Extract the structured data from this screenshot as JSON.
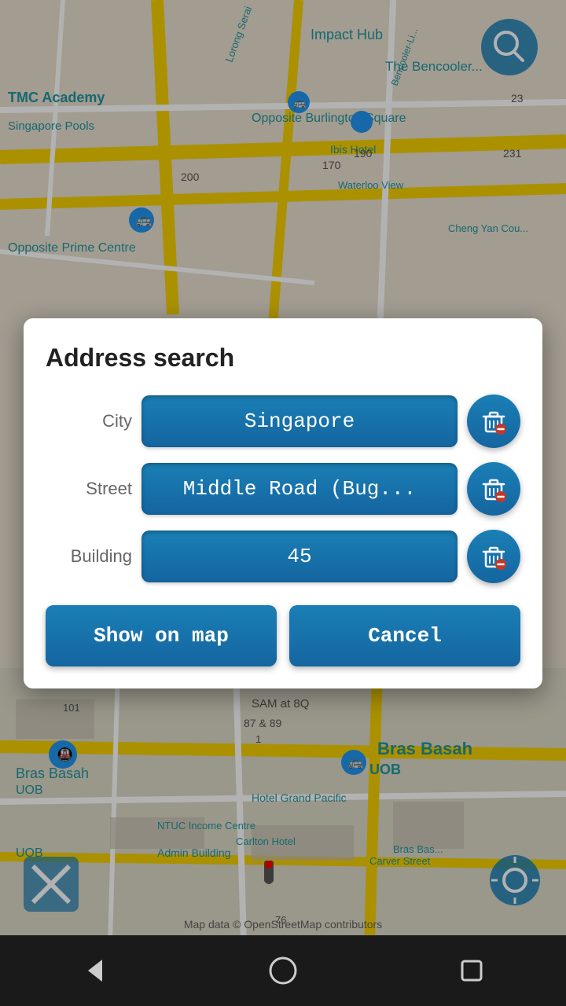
{
  "dialog": {
    "title": "Address search",
    "city_label": "City",
    "city_value": "Singapore",
    "street_label": "Street",
    "street_value": "Middle Road (Bug...",
    "building_label": "Building",
    "building_value": "45",
    "show_on_map_label": "Show on map",
    "cancel_label": "Cancel"
  },
  "map": {
    "credit": "Map data © OpenStreetMap contributors"
  },
  "nav": {
    "back_label": "Back",
    "home_label": "Home",
    "recents_label": "Recents"
  }
}
